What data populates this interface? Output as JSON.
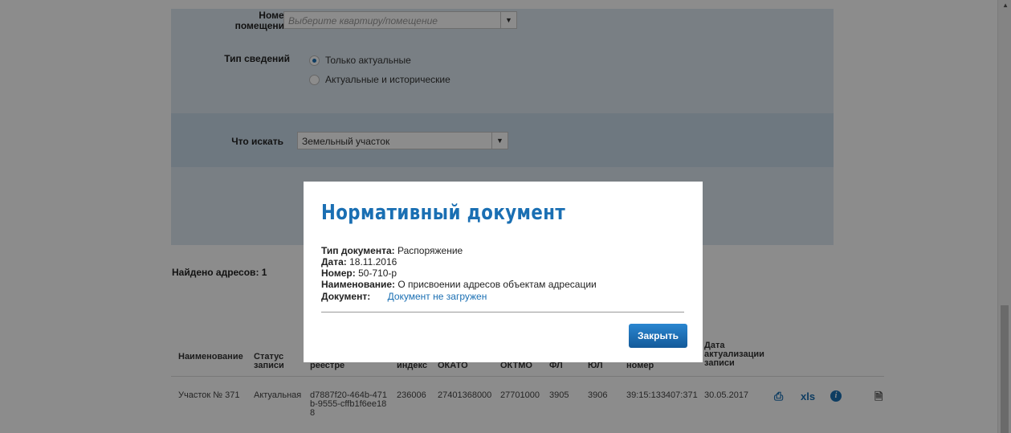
{
  "form": {
    "room_label_line1": "Номер",
    "room_label_line2": "помещения",
    "room_placeholder": "Выберите квартиру/помещение",
    "info_type_label": "Тип сведений",
    "info_type_options": [
      "Только актуальные",
      "Актуальные и исторические"
    ],
    "info_type_selected": 0,
    "search_label": "Что искать",
    "search_value": "Земельный участок"
  },
  "results": {
    "found_text": "Найдено адресов: 1",
    "columns": [
      {
        "line1": "",
        "line2": "",
        "line3": "Наименование"
      },
      {
        "line1": "",
        "line2": "Статус",
        "line3": "записи"
      },
      {
        "line1": "",
        "line2": "",
        "line3": "реестре"
      },
      {
        "line1": "",
        "line2": "",
        "line3": "индекс"
      },
      {
        "line1": "",
        "line2": "",
        "line3": "ОКАТО"
      },
      {
        "line1": "",
        "line2": "",
        "line3": "ОКТМО"
      },
      {
        "line1": "",
        "line2": "",
        "line3": "ФЛ"
      },
      {
        "line1": "",
        "line2": "",
        "line3": "ЮЛ"
      },
      {
        "line1": "",
        "line2": "",
        "line3": "номер"
      },
      {
        "line1": "Дата",
        "line2": "актуализации",
        "line3": "записи"
      }
    ],
    "row": {
      "name": "Участок № 371",
      "status": "Актуальная",
      "guid_l1": "d7887f20-464b-471",
      "guid_l2": "b-9555-cffb1f6ee18",
      "guid_l3": "8",
      "index": "236006",
      "okato": "27401368000",
      "oktmo": "27701000",
      "fl": "3905",
      "ul": "3906",
      "cadastral": "39:15:133407:371",
      "date": "30.05.2017"
    },
    "actions": {
      "xls_label": "xls",
      "info_glyph": "i"
    }
  },
  "modal": {
    "title": "Нормативный документ",
    "doc_type_label": "Тип документа:",
    "doc_type_value": "Распоряжение",
    "date_label": "Дата:",
    "date_value": "18.11.2016",
    "number_label": "Номер:",
    "number_value": "50-710-р",
    "name_label": "Наименование:",
    "name_value": "О присвоении адресов объектам адресации",
    "document_label": "Документ:",
    "document_link": "Документ не загружен",
    "close_label": "Закрыть"
  },
  "colors": {
    "accent": "#1a6fb3",
    "panel": "#dde8f1",
    "band": "#c9daea"
  }
}
